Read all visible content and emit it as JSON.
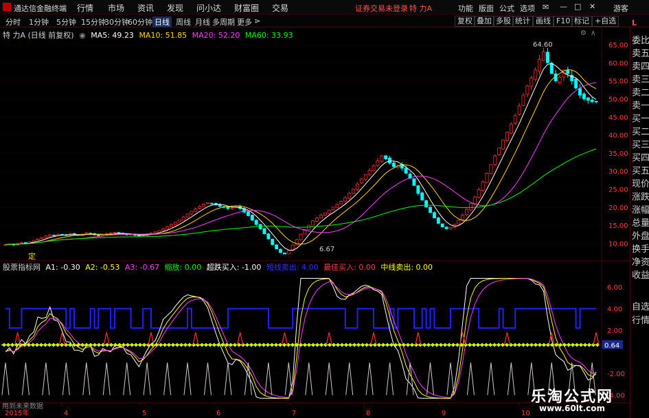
{
  "menubar": {
    "app_title": "通达信金融终端",
    "menus": [
      "行情",
      "市场",
      "资讯",
      "发现",
      "问小达",
      "财富圈",
      "交易"
    ],
    "login_text": "证券交易未登录",
    "stock_name": "特 力A",
    "right_menus": [
      "功能",
      "版面",
      "公式",
      "选项"
    ],
    "guest": "游客"
  },
  "toolbar": {
    "periods": [
      "分时",
      "1分钟",
      "5分钟",
      "15分钟",
      "30分钟",
      "60分钟",
      "日线",
      "周线",
      "月线",
      "多周期",
      "更多"
    ],
    "active_period": "日线",
    "right_buttons": [
      "复权",
      "叠加",
      "多股",
      "统计",
      "画线",
      "F10",
      "标记",
      "+自选"
    ]
  },
  "main_legend": {
    "title": "特 力A (日线 前复权)",
    "ma": [
      {
        "label": "MA5: 49.23",
        "color": "#ffffff"
      },
      {
        "label": "MA10: 51.85",
        "color": "#ffd700"
      },
      {
        "label": "MA20: 52.20",
        "color": "#ff40ff"
      },
      {
        "label": "MA60: 33.93",
        "color": "#00ff00"
      }
    ]
  },
  "indicator_legend": {
    "name": "股票指标网",
    "items": [
      {
        "label": "A1: -0.30",
        "color": "#ffffff"
      },
      {
        "label": "A2: -0.53",
        "color": "#ffff00"
      },
      {
        "label": "A3: -0.67",
        "color": "#ff40ff"
      },
      {
        "label": "缩放: 0.00",
        "color": "#00ff00"
      },
      {
        "label": "超跌买入: -1.00",
        "color": "#ffffff"
      },
      {
        "label": "短线卖出: 4.00",
        "color": "#3030ff"
      },
      {
        "label": "最佳买入: 0.00",
        "color": "#ff4040"
      },
      {
        "label": "中线卖出: 0.00",
        "color": "#ffff00"
      }
    ]
  },
  "price_axis": {
    "ticks": [
      "65.00",
      "60.00",
      "55.00",
      "50.00",
      "45.00",
      "40.00",
      "35.00",
      "30.00",
      "25.00",
      "20.00",
      "15.00",
      "10.00"
    ],
    "values": [
      65,
      60,
      55,
      50,
      45,
      40,
      35,
      30,
      25,
      20,
      15,
      10
    ],
    "min": 5.5,
    "max": 67.5
  },
  "indicator_axis": {
    "ticks": [
      "6.00",
      "4.00",
      "2.00",
      "0.64",
      "-2.00",
      "-4.00"
    ],
    "values": [
      6,
      4,
      2,
      0.64,
      -2,
      -4
    ],
    "current": "0.64",
    "min": -4.6,
    "max": 7.4
  },
  "annotations": {
    "high_label": "64.60",
    "low_label": "6.67",
    "marker": "定",
    "future_note": "用到未来数据"
  },
  "time_axis": {
    "labels": [
      "2015年",
      "4",
      "5",
      "6",
      "7",
      "8",
      "9",
      "10"
    ]
  },
  "right_panel": {
    "items": [
      "委比",
      "卖五",
      "卖四",
      "卖三",
      "卖二",
      "卖一",
      "买一",
      "买二",
      "买三",
      "买四",
      "买五",
      "现价",
      "涨跌",
      "涨幅",
      "总量",
      "外盘",
      "换手",
      "净资",
      "收益",
      "自选",
      "行情"
    ],
    "corner": "L"
  },
  "watermark": {
    "line1": "乐淘公式网",
    "line2": "www.60lt.com"
  },
  "colors": {
    "up": "#ff3030",
    "down": "#00ffff",
    "ma5": "#ffffff",
    "ma10": "#ffd700",
    "ma20": "#ff40ff",
    "ma60": "#00ff00",
    "grid": "#5a0000",
    "blue_line": "#2020ff",
    "zero_line": "#ffff00"
  },
  "chart_data": {
    "type": "line",
    "price_closes": [
      9.6,
      9.8,
      9.5,
      9.9,
      10.2,
      10.0,
      10.4,
      10.8,
      11.2,
      11.6,
      12.0,
      12.3,
      12.1,
      12.5,
      12.4,
      12.2,
      12.6,
      12.4,
      12.2,
      12.5,
      12.8,
      12.6,
      12.3,
      12.2,
      12.4,
      12.6,
      12.8,
      13.0,
      12.7,
      12.5,
      12.3,
      12.4,
      12.2,
      12.0,
      12.3,
      12.6,
      12.8,
      13.1,
      13.5,
      14.0,
      14.6,
      15.2,
      15.8,
      16.5,
      17.3,
      18.1,
      18.8,
      19.5,
      20.2,
      20.8,
      21.2,
      21.0,
      20.6,
      20.2,
      20.0,
      19.6,
      19.8,
      20.2,
      19.6,
      18.6,
      17.6,
      16.4,
      15.2,
      14.0,
      12.6,
      11.2,
      9.6,
      8.4,
      7.4,
      7.0,
      8.0,
      9.5,
      11.0,
      12.5,
      13.8,
      15.0,
      16.2,
      17.0,
      17.8,
      18.4,
      19.2,
      20.0,
      20.8,
      21.6,
      22.6,
      23.8,
      25.0,
      26.4,
      27.8,
      29.0,
      30.2,
      31.4,
      32.8,
      34.2,
      33.4,
      32.2,
      31.2,
      31.6,
      30.8,
      29.4,
      28.0,
      26.0,
      23.8,
      22.0,
      20.0,
      18.5,
      17.0,
      15.5,
      14.5,
      14.0,
      14.4,
      15.2,
      16.4,
      17.8,
      19.4,
      21.0,
      22.8,
      24.8,
      27.0,
      29.4,
      31.8,
      34.2,
      36.4,
      38.6,
      40.8,
      43.0,
      45.4,
      48.0,
      51.0,
      53.6,
      55.8,
      58.0,
      61.0,
      63.0,
      60.0,
      57.0,
      55.0,
      56.0,
      58.0,
      57.0,
      55.0,
      53.0,
      51.0,
      50.0,
      49.6,
      49.2,
      49.3
    ]
  }
}
